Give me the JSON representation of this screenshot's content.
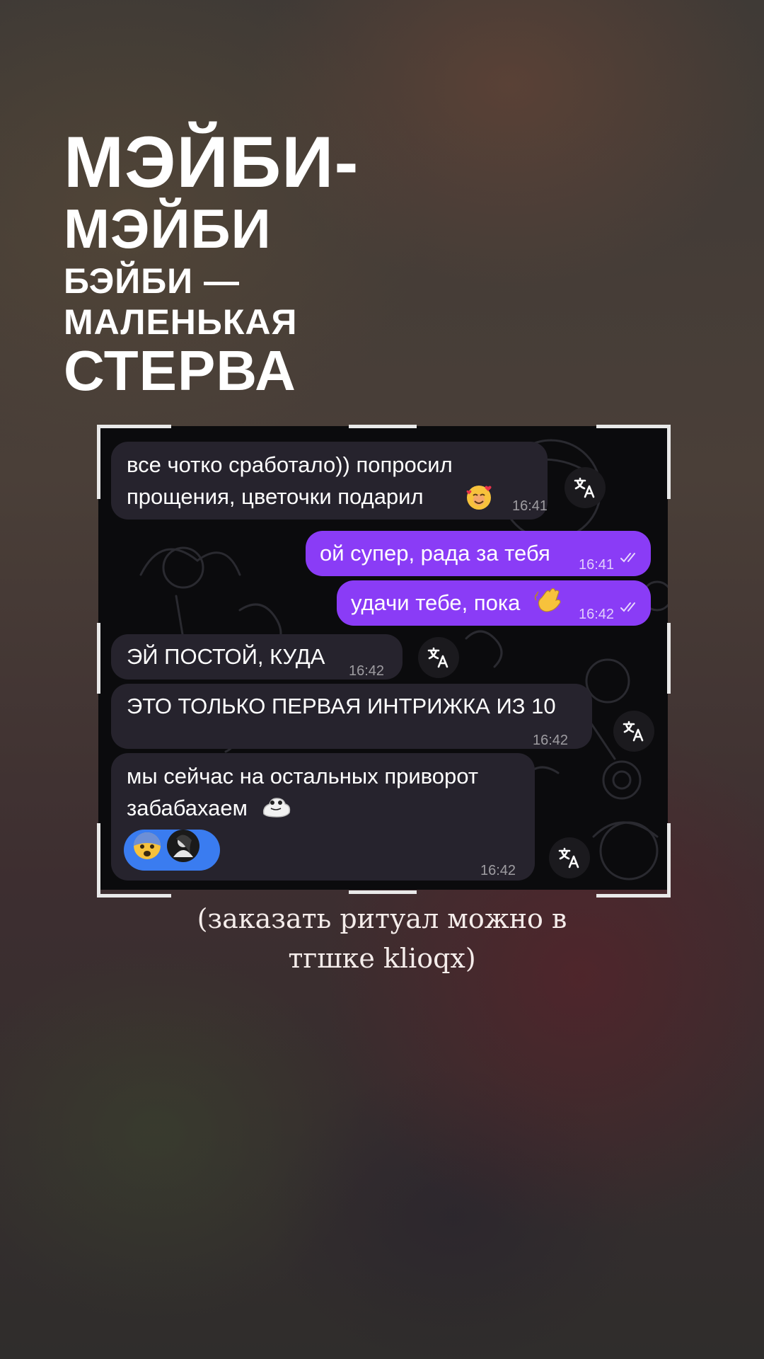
{
  "title": {
    "line1": "МЭЙБИ-",
    "line2": "МЭЙБИ",
    "line3": "БЭЙБИ —",
    "line4": "МАЛЕНЬКАЯ",
    "line5": "СТЕРВА"
  },
  "chat": {
    "messages": [
      {
        "side": "incoming",
        "text": "все чотко сработало)) попросил\nпрощения, цветочки подарил",
        "emoji": "smiling-face-with-hearts",
        "time": "16:41"
      },
      {
        "side": "outgoing",
        "text": "ой супер, рада за тебя",
        "time": "16:41",
        "status": "read"
      },
      {
        "side": "outgoing",
        "text": "удачи тебе, пока",
        "emoji": "waving-hand",
        "time": "16:42",
        "status": "read"
      },
      {
        "side": "incoming",
        "text": "ЭЙ ПОСТОЙ, КУДА",
        "time": "16:42"
      },
      {
        "side": "incoming",
        "text": "ЭТО ТОЛЬКО ПЕРВАЯ ИНТРИЖКА ИЗ 10",
        "time": "16:42"
      },
      {
        "side": "incoming",
        "text": "мы сейчас на остальных приворот\nзабабахаем",
        "emoji": "frog-sticker",
        "time": "16:42",
        "reactions": [
          "fearful-face",
          "user-avatar"
        ]
      }
    ],
    "colors": {
      "incoming": "#26232d",
      "outgoing": "#8a3cf6",
      "reaction": "#3a7cf0",
      "background": "#0b0b0d"
    },
    "translate_icon": "translate-icon"
  },
  "caption": {
    "line1": "(заказать ритуал можно в",
    "line2": "тгшке klioqx)"
  }
}
